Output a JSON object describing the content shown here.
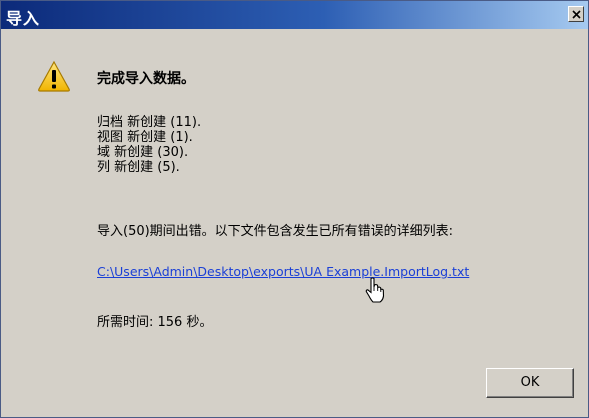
{
  "window": {
    "title": "导入"
  },
  "message": {
    "heading": "完成导入数据。",
    "summary": [
      "归档 新创建 (11).",
      "视图 新创建 (1).",
      "域 新创建 (30).",
      "列 新创建 (5)."
    ],
    "error_text": "导入(50)期间出错。以下文件包含发生已所有错误的详细列表:",
    "log_link": "C:\\Users\\Admin\\Desktop\\exports\\UA Example.ImportLog.txt",
    "elapsed": "所需时间: 156 秒。"
  },
  "buttons": {
    "ok_label": "OK"
  },
  "icons": {
    "warning": "warning-icon",
    "close": "close-icon",
    "cursor": "hand-cursor-icon"
  },
  "colors": {
    "link": "#1a3fd6",
    "titlebar_start": "#0c2a7a",
    "titlebar_end": "#a6caf0",
    "warning_fill": "#f5c400"
  }
}
